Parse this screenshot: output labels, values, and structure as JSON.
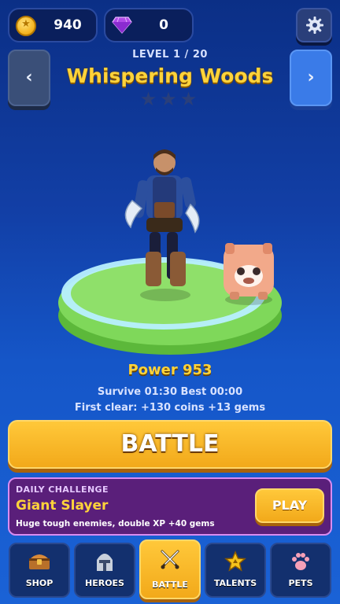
{
  "currency": {
    "coins": "940",
    "gems": "0"
  },
  "level": {
    "label": "LEVEL 1 / 20",
    "title": "Whispering Woods",
    "stars_total": 3,
    "stars_earned": 0
  },
  "nav": {
    "prev": "‹",
    "next": "›"
  },
  "stats": {
    "power": "Power  953",
    "survive": "Survive 01:30   Best 00:00",
    "first_clear": "First clear: +130 coins +13 gems"
  },
  "battle": {
    "label": "BATTLE"
  },
  "daily": {
    "kicker": "DAILY CHALLENGE",
    "title": "Giant Slayer",
    "desc": "Huge tough enemies, double XP  +40 gems",
    "play_label": "PLAY"
  },
  "tabs": [
    {
      "label": "SHOP",
      "icon": "chest-icon"
    },
    {
      "label": "HEROES",
      "icon": "helmet-icon"
    },
    {
      "label": "BATTLE",
      "icon": "crossed-swords-icon",
      "active": true
    },
    {
      "label": "TALENTS",
      "icon": "star-badge-icon"
    },
    {
      "label": "PETS",
      "icon": "paw-icon"
    }
  ],
  "colors": {
    "accent": "#ffd33a",
    "button": "#f2a91a",
    "daily_bg": "#5a1f7a",
    "platform": "#7fd85a"
  }
}
